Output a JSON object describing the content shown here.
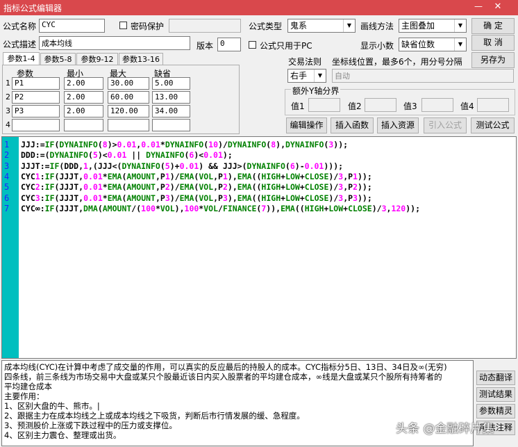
{
  "window": {
    "title": "指标公式编辑器",
    "min_glyph": "—",
    "close_glyph": "✕"
  },
  "form": {
    "name_label": "公式名称",
    "name_value": "CYC",
    "password_label": "密码保护",
    "desc_label": "公式描述",
    "desc_value": "成本均线",
    "version_label": "版本",
    "version_value": "0",
    "pc_only_label": "公式只用于PC",
    "type_label": "公式类型",
    "type_value": "鬼系",
    "draw_label": "画线方法",
    "draw_value": "主图叠加",
    "decimals_label": "显示小数",
    "decimals_value": "缺省位数",
    "trade_rule_label": "交易法则",
    "trade_rule_value": "右手",
    "coord_label": "坐标线位置，最多6个，用分号分隔",
    "coord_placeholder": "自动",
    "extra_y_label": "额外Y轴分界",
    "values": [
      "值1",
      "值2",
      "值3",
      "值4"
    ]
  },
  "buttons": {
    "ok": "确  定",
    "cancel": "取  消",
    "save_as": "另存为",
    "edit_ops": "编辑操作",
    "insert_func": "插入函数",
    "insert_res": "插入资源",
    "import": "引入公式",
    "test": "测试公式"
  },
  "params": {
    "tabs": [
      "参数1-4",
      "参数5-8",
      "参数9-12",
      "参数13-16"
    ],
    "headers": [
      "参数",
      "最小",
      "最大",
      "缺省"
    ],
    "rows": [
      {
        "idx": "1",
        "name": "P1",
        "min": "2.00",
        "max": "30.00",
        "def": "5.00"
      },
      {
        "idx": "2",
        "name": "P2",
        "min": "2.00",
        "max": "60.00",
        "def": "13.00"
      },
      {
        "idx": "3",
        "name": "P3",
        "min": "2.00",
        "max": "120.00",
        "def": "34.00"
      },
      {
        "idx": "4",
        "name": "",
        "min": "",
        "max": "",
        "def": ""
      }
    ]
  },
  "code_lines": [
    "JJJ:=IF(DYNAINFO(8)>0.01,0.01*DYNAINFO(10)/DYNAINFO(8),DYNAINFO(3));",
    "DDD:=(DYNAINFO(5)<0.01 || DYNAINFO(6)<0.01);",
    "JJJT:=IF(DDD,1,(JJJ<(DYNAINFO(5)+0.01) && JJJ>(DYNAINFO(6)-0.01)));",
    "CYC1:IF(JJJT,0.01*EMA(AMOUNT,P1)/EMA(VOL,P1),EMA((HIGH+LOW+CLOSE)/3,P1));",
    "CYC2:IF(JJJT,0.01*EMA(AMOUNT,P2)/EMA(VOL,P2),EMA((HIGH+LOW+CLOSE)/3,P2));",
    "CYC3:IF(JJJT,0.01*EMA(AMOUNT,P3)/EMA(VOL,P3),EMA((HIGH+LOW+CLOSE)/3,P3));",
    "CYC∞:IF(JJJT,DMA(AMOUNT/(100*VOL),100*VOL/FINANCE(7)),EMA((HIGH+LOW+CLOSE)/3,120));"
  ],
  "line_numbers": [
    "1",
    "2",
    "3",
    "4",
    "5",
    "6",
    "7"
  ],
  "description_lines": [
    "成本均线(CYC)在计算中考虑了成交量的作用，可以真实的反应最后的持股人的成本。CYC指标分5日、13日、34日及∞(无穷)",
    "四条线，前三条线为市场交易中大盘或某只个股最近该日内买入股票者的平均建仓成本，∞线是大盘或某只个股所有持筹者的",
    "平均建仓成本",
    "主要作用：",
    "1、区别大盘的牛、熊市。|",
    "2、跟据主力在成本均线之上或成本均线之下吸货，判断后市行情发展的缓、急程度。",
    "3、预测股价上涨或下跌过程中的压力或支撑位。",
    "4、区别主力震仓、整理或出货。"
  ],
  "side_buttons": [
    "动态翻译",
    "测试结果",
    "参数精灵",
    "用法注释"
  ],
  "watermark": "头条 @金融碎片集"
}
